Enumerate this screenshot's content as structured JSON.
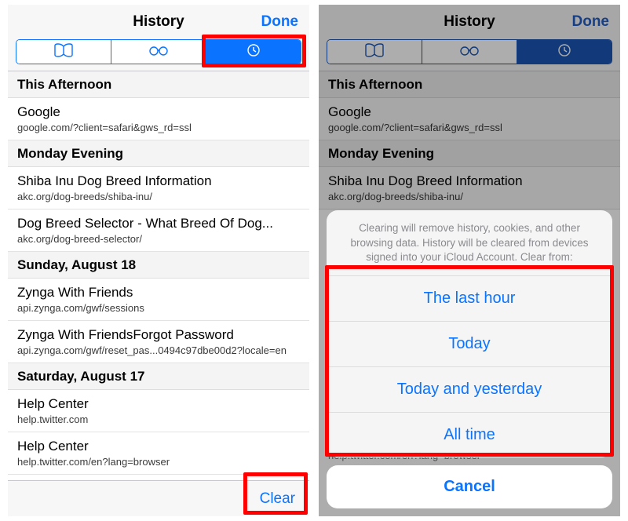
{
  "colors": {
    "ios_blue": "#0a73ff",
    "highlight": "#ff0000"
  },
  "header": {
    "title": "History",
    "done": "Done"
  },
  "footer": {
    "clear": "Clear"
  },
  "sections": [
    {
      "label": "This Afternoon",
      "rows": [
        {
          "title": "Google",
          "sub": "google.com/?client=safari&gws_rd=ssl"
        }
      ]
    },
    {
      "label": "Monday Evening",
      "rows": [
        {
          "title": "Shiba Inu Dog Breed Information",
          "sub": "akc.org/dog-breeds/shiba-inu/"
        },
        {
          "title": "Dog Breed Selector - What Breed Of Dog...",
          "sub": "akc.org/dog-breed-selector/"
        }
      ]
    },
    {
      "label": "Sunday, August 18",
      "rows": [
        {
          "title": "Zynga With Friends",
          "sub": "api.zynga.com/gwf/sessions"
        },
        {
          "title": "Zynga With FriendsForgot Password",
          "sub": "api.zynga.com/gwf/reset_pas...0494c97dbe00d2?locale=en"
        }
      ]
    },
    {
      "label": "Saturday, August 17",
      "rows": [
        {
          "title": "Help Center",
          "sub": "help.twitter.com"
        },
        {
          "title": "Help Center",
          "sub": "help.twitter.com/en?lang=browser"
        }
      ]
    }
  ],
  "sections_right_visible": [
    {
      "label": "This Afternoon",
      "rows": [
        {
          "title": "Google",
          "sub": "google.com/?client=safari&gws_rd=ssl"
        }
      ]
    },
    {
      "label": "Monday Evening",
      "rows": [
        {
          "title": "Shiba Inu Dog Breed Information",
          "sub": "akc.org/dog-breeds/shiba-inu/"
        }
      ]
    }
  ],
  "peek_row": {
    "sub": "help.twitter.com/en?lang=browser"
  },
  "sheet": {
    "message": "Clearing will remove history, cookies, and other browsing data. History will be cleared from devices signed into your iCloud Account. Clear from:",
    "options": [
      "The last hour",
      "Today",
      "Today and yesterday",
      "All time"
    ],
    "cancel": "Cancel"
  }
}
